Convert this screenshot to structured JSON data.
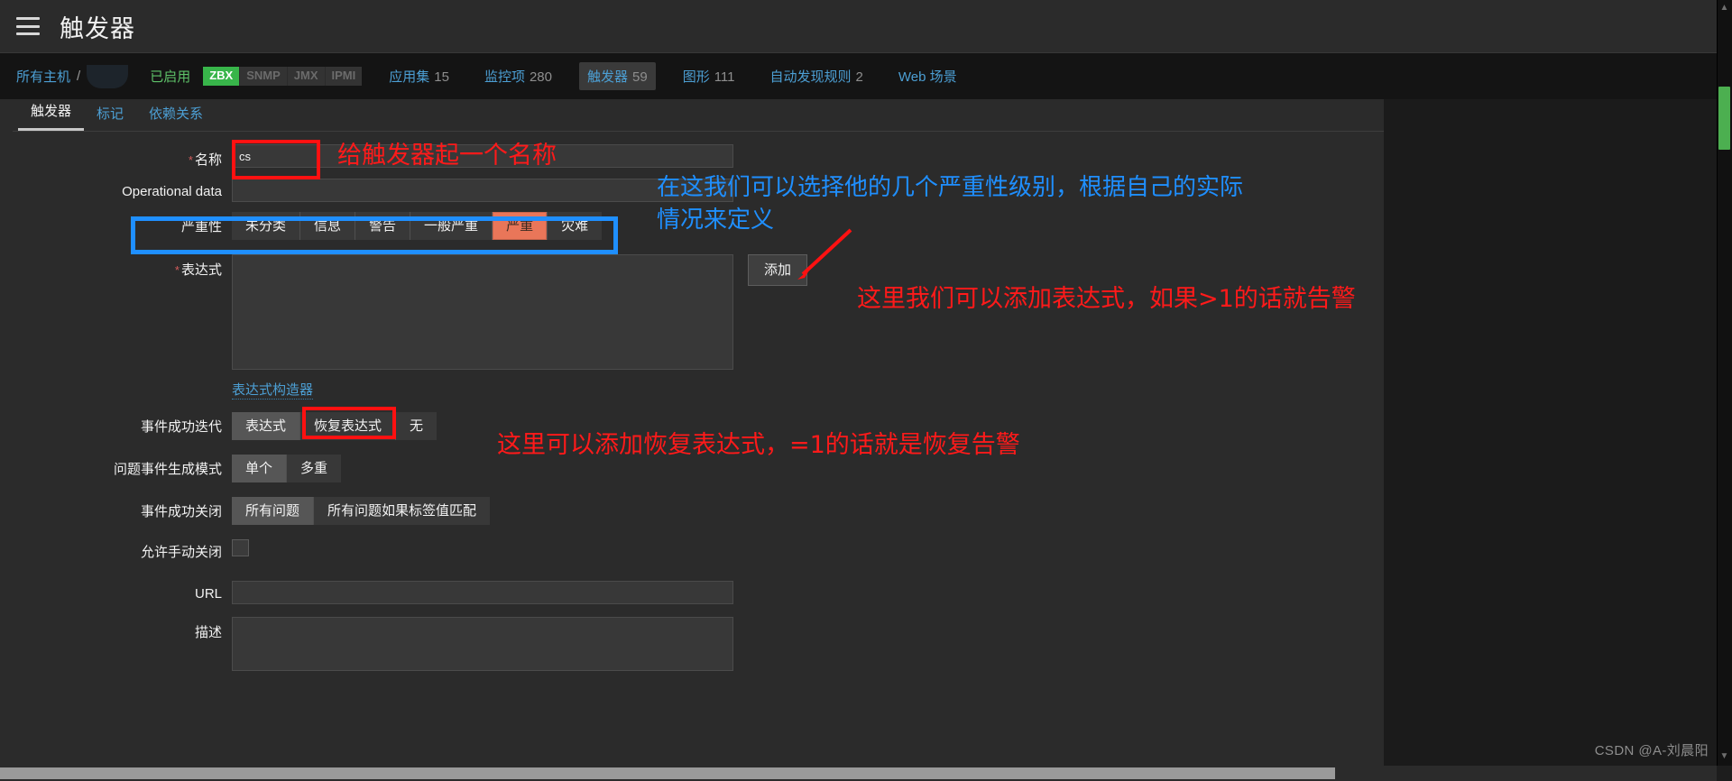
{
  "window": {
    "title": "触发器",
    "menu_icon": "hamburger-icon"
  },
  "breadcrumb": {
    "all_hosts": "所有主机",
    "separator": "/",
    "host_name_redacted": "",
    "status": "已启用",
    "interfaces": [
      {
        "label": "ZBX",
        "active": true
      },
      {
        "label": "SNMP",
        "active": false
      },
      {
        "label": "JMX",
        "active": false
      },
      {
        "label": "IPMI",
        "active": false
      }
    ],
    "items": [
      {
        "label": "应用集",
        "count": "15",
        "selected": false
      },
      {
        "label": "监控项",
        "count": "280",
        "selected": false
      },
      {
        "label": "触发器",
        "count": "59",
        "selected": true
      },
      {
        "label": "图形",
        "count": "111",
        "selected": false
      },
      {
        "label": "自动发现规则",
        "count": "2",
        "selected": false
      },
      {
        "label": "Web 场景",
        "count": "",
        "selected": false
      }
    ]
  },
  "tabs": [
    {
      "label": "触发器",
      "active": true
    },
    {
      "label": "标记",
      "active": false
    },
    {
      "label": "依赖关系",
      "active": false
    }
  ],
  "form": {
    "name": {
      "label": "名称",
      "required": true,
      "value": "cs",
      "placeholder": ""
    },
    "operational_data": {
      "label": "Operational data",
      "required": false,
      "value": "",
      "placeholder": ""
    },
    "severity": {
      "label": "严重性",
      "options": [
        {
          "label": "未分类",
          "selected": false
        },
        {
          "label": "信息",
          "selected": false
        },
        {
          "label": "警告",
          "selected": false
        },
        {
          "label": "一般严重",
          "selected": false
        },
        {
          "label": "严重",
          "selected": true
        },
        {
          "label": "灾难",
          "selected": false
        }
      ]
    },
    "expression": {
      "label": "表达式",
      "required": true,
      "value": "",
      "add_button": "添加",
      "constructor_link": "表达式构造器"
    },
    "recovery_mode": {
      "label": "事件成功迭代",
      "options": [
        {
          "label": "表达式",
          "selected": true
        },
        {
          "label": "恢复表达式",
          "selected": false
        },
        {
          "label": "无",
          "selected": false
        }
      ]
    },
    "problem_event_mode": {
      "label": "问题事件生成模式",
      "options": [
        {
          "label": "单个",
          "selected": true
        },
        {
          "label": "多重",
          "selected": false
        }
      ]
    },
    "ok_event_closes": {
      "label": "事件成功关闭",
      "options": [
        {
          "label": "所有问题",
          "selected": true
        },
        {
          "label": "所有问题如果标签值匹配",
          "selected": false
        }
      ]
    },
    "allow_manual_close": {
      "label": "允许手动关闭",
      "checked": false
    },
    "url": {
      "label": "URL",
      "value": "",
      "placeholder": ""
    },
    "description": {
      "label": "描述",
      "value": "",
      "placeholder": ""
    }
  },
  "annotations": [
    {
      "id": "name-note",
      "text": "给触发器起一个名称",
      "color": "#ff1a1a"
    },
    {
      "id": "severity-note",
      "text": "在这我们可以选择他的几个严重性级别，根据自己的实际\n情况来定义",
      "color": "#1f8fff"
    },
    {
      "id": "expression-note",
      "text": "这里我们可以添加表达式，如果>1的话就告警",
      "color": "#ff1a1a"
    },
    {
      "id": "recovery-note",
      "text": "这里可以添加恢复表达式，=1的话就是恢复告警",
      "color": "#ff1a1a"
    }
  ],
  "highlight_boxes": [
    {
      "id": "name-field-box",
      "color": "#ff1111"
    },
    {
      "id": "severity-row-box",
      "color": "#1f8fff"
    },
    {
      "id": "recovery-expression-box",
      "color": "#ff1111"
    }
  ],
  "watermark": "CSDN @A-刘晨阳"
}
